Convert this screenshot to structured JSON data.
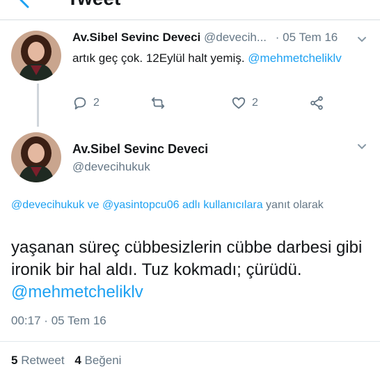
{
  "header": {
    "title": "Tweet"
  },
  "tweet1": {
    "name": "Av.Sibel Sevinc Deveci",
    "handle": "@devecih...",
    "separator": "·",
    "date": "05 Tem 16",
    "text": "artık geç çok. 12Eylül halt yemiş.",
    "mention": "@mehmetcheliklv",
    "replies": "2",
    "likes": "2"
  },
  "tweet2": {
    "name": "Av.Sibel Sevinc Deveci",
    "handle": "@devecihukuk",
    "reply_prefix_mention1": "@devecihukuk",
    "reply_joiner": "ve",
    "reply_prefix_mention2": "@yasintopcu06 adlı kullanıcılara",
    "reply_suffix": "yanıt olarak",
    "text": "yaşanan süreç cübbesizlerin cübbe darbesi gibi ironik bir hal aldı. Tuz kokmadı; çürüdü.",
    "mention": "@mehmetcheliklv",
    "time": "00:17",
    "date": "05 Tem 16",
    "retweets_count": "5",
    "retweets_label": "Retweet",
    "likes_count": "4",
    "likes_label": "Beğeni"
  },
  "colors": {
    "accent": "#1da1f2",
    "muted": "#657786",
    "text": "#14171a"
  }
}
